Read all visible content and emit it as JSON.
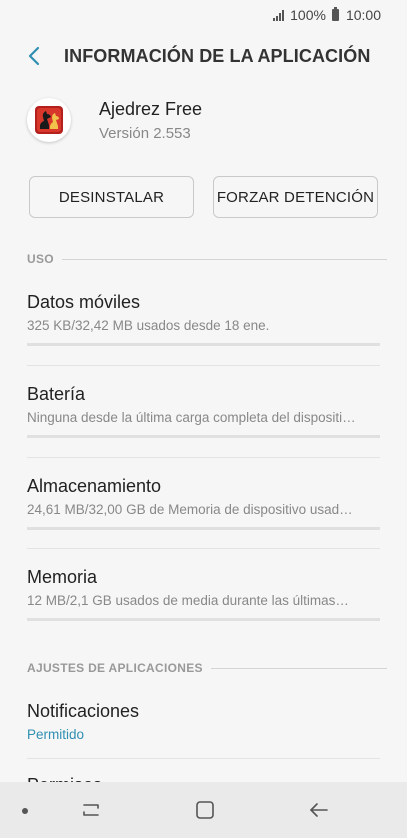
{
  "status_bar": {
    "battery_percent": "100%",
    "time": "10:00"
  },
  "header": {
    "title": "INFORMACIÓN DE LA APLICACIÓN"
  },
  "app": {
    "name": "Ajedrez Free",
    "version": "Versión 2.553"
  },
  "actions": {
    "uninstall_label": "DESINSTALAR",
    "force_stop_label": "FORZAR DETENCIÓN"
  },
  "sections": {
    "usage": "USO",
    "app_settings": "AJUSTES DE APLICACIONES"
  },
  "usage_items": [
    {
      "title": "Datos móviles",
      "subtitle": "325 KB/32,42 MB usados desde 18 ene."
    },
    {
      "title": "Batería",
      "subtitle": "Ninguna desde la última carga completa del dispositi…"
    },
    {
      "title": "Almacenamiento",
      "subtitle": "24,61 MB/32,00 GB de Memoria de dispositivo usad…"
    },
    {
      "title": "Memoria",
      "subtitle": "12 MB/2,1 GB usados de media durante las últimas…"
    }
  ],
  "settings_items": [
    {
      "title": "Notificaciones",
      "subtitle": "Permitido"
    },
    {
      "title": "Permisos"
    }
  ],
  "colors": {
    "accent": "#2f8fb2",
    "background": "#f6f6f6"
  }
}
